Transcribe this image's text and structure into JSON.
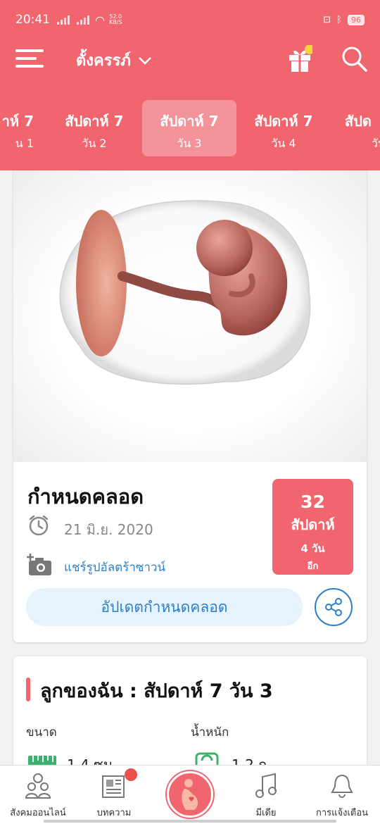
{
  "status_bar": {
    "time": "20:41",
    "net_speed_value": "52.0",
    "net_speed_unit": "KB/S",
    "battery": "96"
  },
  "header": {
    "title": "ตั้งครรภ์",
    "icons": [
      "menu-icon",
      "gift-icon",
      "search-icon"
    ]
  },
  "day_tabs": [
    {
      "week": "าห์ 7",
      "day": "น 1"
    },
    {
      "week": "สัปดาห์ 7",
      "day": "วัน 2"
    },
    {
      "week": "สัปดาห์ 7",
      "day": "วัน 3"
    },
    {
      "week": "สัปดาห์ 7",
      "day": "วัน 4"
    },
    {
      "week": "สัปด",
      "day": "วัน"
    }
  ],
  "due_card": {
    "due_label": "กำหนดคลอด",
    "due_date": "21 มิ.ย. 2020",
    "share_ultrasound": "แชร์รูปอัลตร้าซาวน์",
    "countdown_number": "32",
    "countdown_unit": "สัปดาห์",
    "countdown_days": "4 วัน",
    "countdown_more": "อีก",
    "update_button": "อัปเดตกำหนดคลอด"
  },
  "baby_card": {
    "heading": "ลูกของฉัน : สัปดาห์ 7 วัน 3",
    "size_label": "ขนาด",
    "size_value": "1.4 ซม",
    "weight_label": "น้ำหนัก",
    "weight_value": "1.2 ก"
  },
  "bottom_nav": [
    {
      "label": "สังคมออนไลน์",
      "icon": "community-icon"
    },
    {
      "label": "บทความ",
      "icon": "articles-icon"
    },
    {
      "label": "",
      "icon": "pregnancy-icon"
    },
    {
      "label": "มีเดีย",
      "icon": "music-icon"
    },
    {
      "label": "การแจ้งเตือน",
      "icon": "bell-icon"
    }
  ],
  "colors": {
    "primary": "#f0656e",
    "link": "#2a7fc9",
    "button_bg": "#e6f3fc"
  }
}
